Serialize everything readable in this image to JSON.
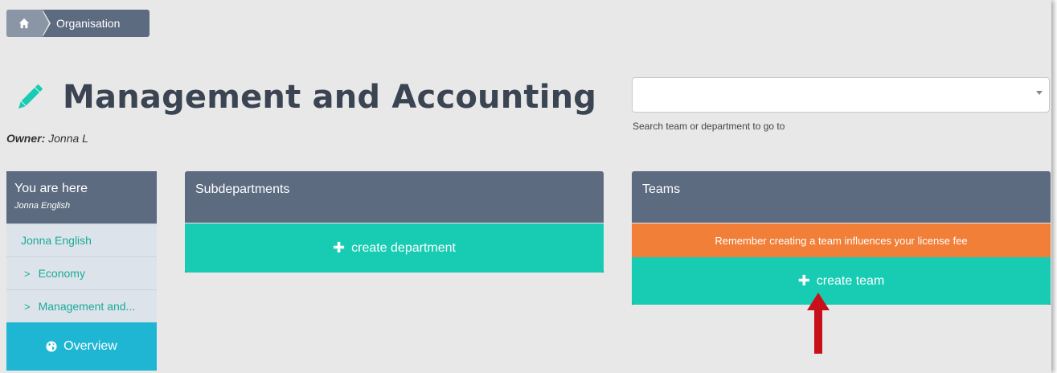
{
  "breadcrumb": {
    "home_icon": "home-icon",
    "label": "Organisation"
  },
  "header": {
    "title": "Management and Accounting",
    "title_icon": "pencil-icon",
    "owner_label": "Owner:",
    "owner_name": "Jonna L"
  },
  "search": {
    "value": "",
    "help": "Search team or department to go to"
  },
  "nav": {
    "title": "You are here",
    "subtitle": "Jonna English",
    "items": [
      {
        "label": "Jonna English"
      },
      {
        "label": "Economy"
      },
      {
        "label": "Management and..."
      }
    ],
    "overview_label": "Overview",
    "overview_icon": "globe-icon"
  },
  "subdepartments": {
    "title": "Subdepartments",
    "create_label": "create department"
  },
  "teams": {
    "title": "Teams",
    "warning": "Remember creating a team influences your license fee",
    "create_label": "create team"
  },
  "colors": {
    "header_bg": "#5d6b80",
    "accent_green": "#17ccb2",
    "warning_orange": "#f27f38",
    "overview_blue": "#1fb6d4",
    "annotation_arrow": "#c8101a"
  }
}
